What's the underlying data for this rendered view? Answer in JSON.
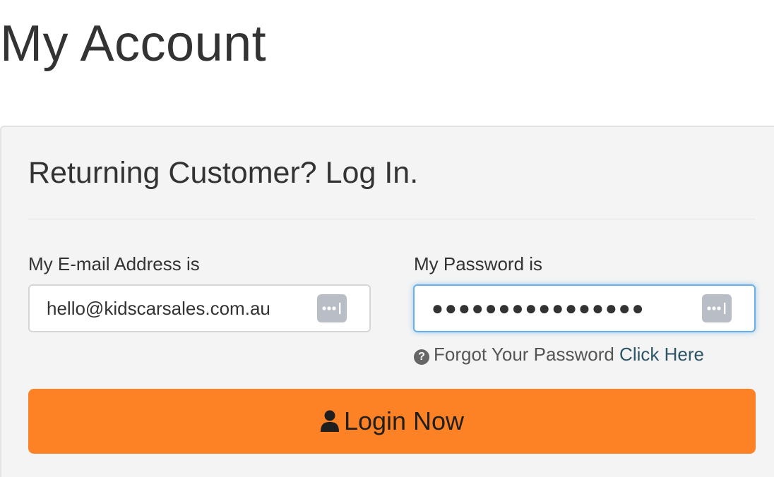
{
  "page": {
    "title": "My Account"
  },
  "login_panel": {
    "heading": "Returning Customer? Log In.",
    "email": {
      "label": "My E-mail Address is",
      "value": "hello@kidscarsales.com.au",
      "icon": "keychain-icon"
    },
    "password": {
      "label": "My Password is",
      "value": "●●●●●●●●●●●●●●●●",
      "icon": "keychain-icon",
      "focused": true
    },
    "forgot": {
      "icon": "question-circle-icon",
      "text": "Forgot Your Password",
      "link_text": "Click Here"
    },
    "login_button": {
      "icon": "user-icon",
      "label": "Login Now"
    }
  },
  "colors": {
    "accent": "#fd8125",
    "panel_background": "#f4f4f4",
    "focus_border": "#66afe9",
    "link": "#2d5566"
  }
}
